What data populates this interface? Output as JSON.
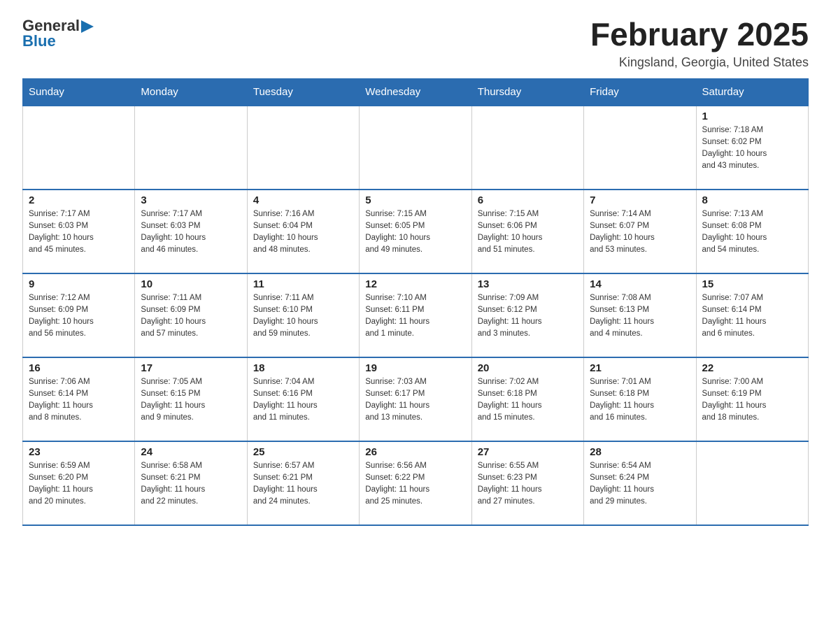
{
  "header": {
    "logo_text_general": "General",
    "logo_text_blue": "Blue",
    "month_title": "February 2025",
    "location": "Kingsland, Georgia, United States"
  },
  "days_of_week": [
    "Sunday",
    "Monday",
    "Tuesday",
    "Wednesday",
    "Thursday",
    "Friday",
    "Saturday"
  ],
  "weeks": [
    {
      "days": [
        {
          "number": "",
          "info": ""
        },
        {
          "number": "",
          "info": ""
        },
        {
          "number": "",
          "info": ""
        },
        {
          "number": "",
          "info": ""
        },
        {
          "number": "",
          "info": ""
        },
        {
          "number": "",
          "info": ""
        },
        {
          "number": "1",
          "info": "Sunrise: 7:18 AM\nSunset: 6:02 PM\nDaylight: 10 hours\nand 43 minutes."
        }
      ]
    },
    {
      "days": [
        {
          "number": "2",
          "info": "Sunrise: 7:17 AM\nSunset: 6:03 PM\nDaylight: 10 hours\nand 45 minutes."
        },
        {
          "number": "3",
          "info": "Sunrise: 7:17 AM\nSunset: 6:03 PM\nDaylight: 10 hours\nand 46 minutes."
        },
        {
          "number": "4",
          "info": "Sunrise: 7:16 AM\nSunset: 6:04 PM\nDaylight: 10 hours\nand 48 minutes."
        },
        {
          "number": "5",
          "info": "Sunrise: 7:15 AM\nSunset: 6:05 PM\nDaylight: 10 hours\nand 49 minutes."
        },
        {
          "number": "6",
          "info": "Sunrise: 7:15 AM\nSunset: 6:06 PM\nDaylight: 10 hours\nand 51 minutes."
        },
        {
          "number": "7",
          "info": "Sunrise: 7:14 AM\nSunset: 6:07 PM\nDaylight: 10 hours\nand 53 minutes."
        },
        {
          "number": "8",
          "info": "Sunrise: 7:13 AM\nSunset: 6:08 PM\nDaylight: 10 hours\nand 54 minutes."
        }
      ]
    },
    {
      "days": [
        {
          "number": "9",
          "info": "Sunrise: 7:12 AM\nSunset: 6:09 PM\nDaylight: 10 hours\nand 56 minutes."
        },
        {
          "number": "10",
          "info": "Sunrise: 7:11 AM\nSunset: 6:09 PM\nDaylight: 10 hours\nand 57 minutes."
        },
        {
          "number": "11",
          "info": "Sunrise: 7:11 AM\nSunset: 6:10 PM\nDaylight: 10 hours\nand 59 minutes."
        },
        {
          "number": "12",
          "info": "Sunrise: 7:10 AM\nSunset: 6:11 PM\nDaylight: 11 hours\nand 1 minute."
        },
        {
          "number": "13",
          "info": "Sunrise: 7:09 AM\nSunset: 6:12 PM\nDaylight: 11 hours\nand 3 minutes."
        },
        {
          "number": "14",
          "info": "Sunrise: 7:08 AM\nSunset: 6:13 PM\nDaylight: 11 hours\nand 4 minutes."
        },
        {
          "number": "15",
          "info": "Sunrise: 7:07 AM\nSunset: 6:14 PM\nDaylight: 11 hours\nand 6 minutes."
        }
      ]
    },
    {
      "days": [
        {
          "number": "16",
          "info": "Sunrise: 7:06 AM\nSunset: 6:14 PM\nDaylight: 11 hours\nand 8 minutes."
        },
        {
          "number": "17",
          "info": "Sunrise: 7:05 AM\nSunset: 6:15 PM\nDaylight: 11 hours\nand 9 minutes."
        },
        {
          "number": "18",
          "info": "Sunrise: 7:04 AM\nSunset: 6:16 PM\nDaylight: 11 hours\nand 11 minutes."
        },
        {
          "number": "19",
          "info": "Sunrise: 7:03 AM\nSunset: 6:17 PM\nDaylight: 11 hours\nand 13 minutes."
        },
        {
          "number": "20",
          "info": "Sunrise: 7:02 AM\nSunset: 6:18 PM\nDaylight: 11 hours\nand 15 minutes."
        },
        {
          "number": "21",
          "info": "Sunrise: 7:01 AM\nSunset: 6:18 PM\nDaylight: 11 hours\nand 16 minutes."
        },
        {
          "number": "22",
          "info": "Sunrise: 7:00 AM\nSunset: 6:19 PM\nDaylight: 11 hours\nand 18 minutes."
        }
      ]
    },
    {
      "days": [
        {
          "number": "23",
          "info": "Sunrise: 6:59 AM\nSunset: 6:20 PM\nDaylight: 11 hours\nand 20 minutes."
        },
        {
          "number": "24",
          "info": "Sunrise: 6:58 AM\nSunset: 6:21 PM\nDaylight: 11 hours\nand 22 minutes."
        },
        {
          "number": "25",
          "info": "Sunrise: 6:57 AM\nSunset: 6:21 PM\nDaylight: 11 hours\nand 24 minutes."
        },
        {
          "number": "26",
          "info": "Sunrise: 6:56 AM\nSunset: 6:22 PM\nDaylight: 11 hours\nand 25 minutes."
        },
        {
          "number": "27",
          "info": "Sunrise: 6:55 AM\nSunset: 6:23 PM\nDaylight: 11 hours\nand 27 minutes."
        },
        {
          "number": "28",
          "info": "Sunrise: 6:54 AM\nSunset: 6:24 PM\nDaylight: 11 hours\nand 29 minutes."
        },
        {
          "number": "",
          "info": ""
        }
      ]
    }
  ]
}
